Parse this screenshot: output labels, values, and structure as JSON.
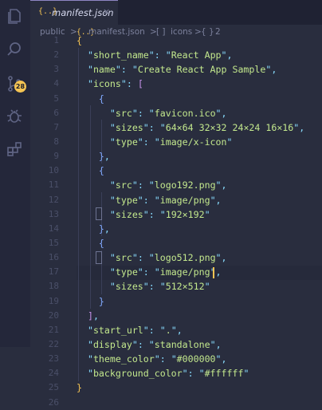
{
  "activity_bar": {
    "icons": [
      "files-icon",
      "search-icon",
      "source-control-icon",
      "debug-icon",
      "extensions-icon"
    ],
    "scm_badge": "28"
  },
  "tab": {
    "icon": "{..}",
    "label": "manifest.json",
    "close": "×"
  },
  "breadcrumb": {
    "items": [
      "public",
      ">",
      "{..}",
      "manifest.json",
      ">",
      "[ ]",
      "icons",
      ">",
      "{ }",
      "2"
    ]
  },
  "code_lines": [
    {
      "num": "1",
      "text": "{"
    },
    {
      "num": "2",
      "text": "  \"short_name\": \"React App\","
    },
    {
      "num": "3",
      "text": "  \"name\": \"Create React App Sample\","
    },
    {
      "num": "4",
      "text": "  \"icons\": ["
    },
    {
      "num": "5",
      "text": "    {"
    },
    {
      "num": "6",
      "text": "      \"src\": \"favicon.ico\","
    },
    {
      "num": "7",
      "text": "      \"sizes\": \"64×64 32×32 24×24 16×16\","
    },
    {
      "num": "8",
      "text": "      \"type\": \"image/x-icon\""
    },
    {
      "num": "9",
      "text": "    },"
    },
    {
      "num": "10",
      "text": "    {"
    },
    {
      "num": "11",
      "text": "      \"src\": \"logo192.png\","
    },
    {
      "num": "12",
      "text": "      \"type\": \"image/png\","
    },
    {
      "num": "13",
      "text": "      \"sizes\": \"192×192\""
    },
    {
      "num": "14",
      "text": "    },"
    },
    {
      "num": "15",
      "text": "    {"
    },
    {
      "num": "16",
      "text": "      \"src\": \"logo512.png\","
    },
    {
      "num": "17",
      "text": "      \"type\": \"image/png\","
    },
    {
      "num": "18",
      "text": "      \"sizes\": \"512×512\""
    },
    {
      "num": "19",
      "text": "    }"
    },
    {
      "num": "20",
      "text": "  ],"
    },
    {
      "num": "21",
      "text": "  \"start_url\": \".\","
    },
    {
      "num": "22",
      "text": "  \"display\": \"standalone\","
    },
    {
      "num": "23",
      "text": "  \"theme_color\": \"#000000\","
    },
    {
      "num": "24",
      "text": "  \"background_color\": \"#ffffff\""
    },
    {
      "num": "25",
      "text": "}"
    },
    {
      "num": "26",
      "text": ""
    }
  ],
  "colors": {
    "background": "#292d3e",
    "key": "#c3e88d",
    "string": "#c3e88d",
    "punctuation": "#89ddff",
    "bracket_level1": "#f5c453",
    "bracket_level2": "#c792ea",
    "bracket_level3": "#82aaff",
    "line_number": "#4a4f68",
    "cursor": "#f5c453"
  }
}
